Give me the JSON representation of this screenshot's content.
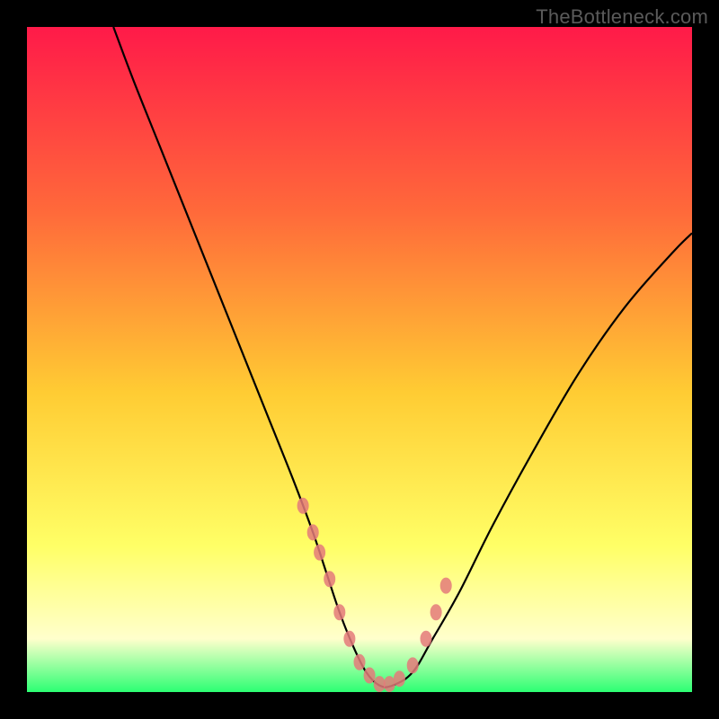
{
  "watermark": "TheBottleneck.com",
  "chart_data": {
    "type": "line",
    "title": "",
    "xlabel": "",
    "ylabel": "",
    "xlim": [
      0,
      100
    ],
    "ylim": [
      0,
      100
    ],
    "gradient_stops": [
      {
        "offset": 0,
        "color": "#ff1a49"
      },
      {
        "offset": 28,
        "color": "#ff6a3a"
      },
      {
        "offset": 55,
        "color": "#ffcc33"
      },
      {
        "offset": 78,
        "color": "#ffff66"
      },
      {
        "offset": 92,
        "color": "#ffffcc"
      },
      {
        "offset": 100,
        "color": "#2cff73"
      }
    ],
    "series": [
      {
        "name": "bottleneck-curve",
        "color": "#000000",
        "type": "line",
        "x": [
          13,
          16,
          20,
          24,
          28,
          32,
          36,
          40,
          43,
          45,
          47,
          49,
          51,
          53,
          55,
          58,
          61,
          65,
          70,
          76,
          83,
          90,
          97,
          100
        ],
        "y": [
          100,
          92,
          82,
          72,
          62,
          52,
          42,
          32,
          24,
          18,
          12,
          7,
          3,
          1,
          1,
          3,
          8,
          15,
          25,
          36,
          48,
          58,
          66,
          69
        ]
      },
      {
        "name": "marker-dots",
        "color": "#e47a7a",
        "type": "scatter",
        "x": [
          41.5,
          43.0,
          44.0,
          45.5,
          47.0,
          48.5,
          50.0,
          51.5,
          53.0,
          54.5,
          56.0,
          58.0,
          60.0,
          61.5,
          63.0
        ],
        "y": [
          28.0,
          24.0,
          21.0,
          17.0,
          12.0,
          8.0,
          4.5,
          2.5,
          1.2,
          1.2,
          2.0,
          4.0,
          8.0,
          12.0,
          16.0
        ]
      }
    ]
  }
}
